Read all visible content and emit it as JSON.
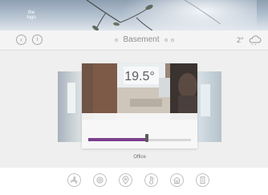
{
  "header": {
    "logo_text": "the logo",
    "room_title": "Basement",
    "weather": {
      "temperature": "2°",
      "icon": "cloud-icon"
    }
  },
  "nav": {
    "back_icon": "back-icon",
    "info_icon": "info-icon"
  },
  "room_card": {
    "temperature": "19.5°",
    "setpoint_fraction": 0.57,
    "room_name": "Office",
    "accent_color": "#7b3f8e"
  },
  "bottom_nav": [
    {
      "icon": "fan-icon"
    },
    {
      "icon": "power-icon"
    },
    {
      "icon": "location-icon"
    },
    {
      "icon": "thermostat-icon"
    },
    {
      "icon": "home-icon"
    },
    {
      "icon": "building-icon"
    }
  ]
}
